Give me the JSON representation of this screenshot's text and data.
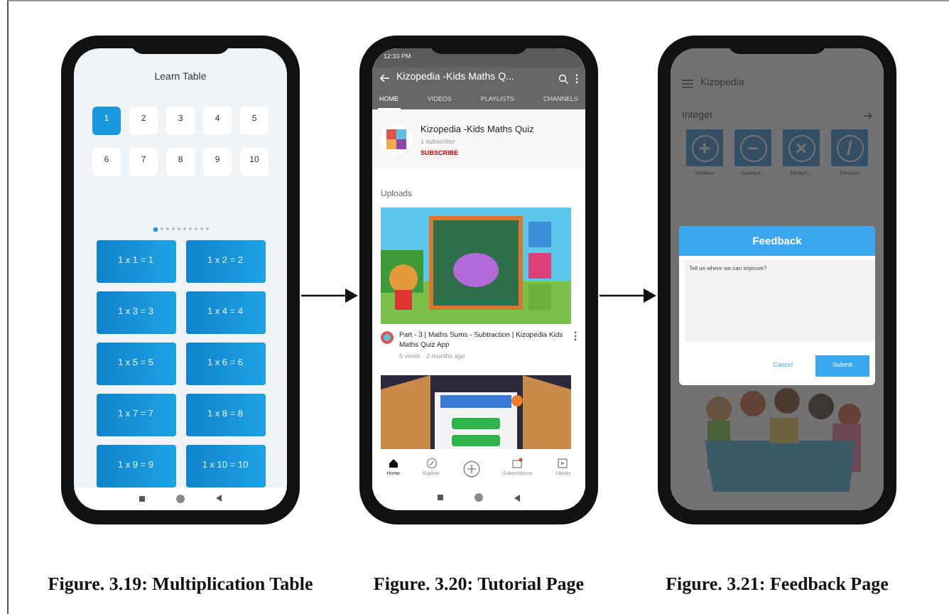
{
  "figures": [
    {
      "kind": "table",
      "caption": "Figure. 3.19: Multiplication Table",
      "title": "Learn Table",
      "numbers": [
        {
          "label": "1",
          "selected": true
        },
        {
          "label": "2",
          "selected": false
        },
        {
          "label": "3",
          "selected": false
        },
        {
          "label": "4",
          "selected": false
        },
        {
          "label": "5",
          "selected": false
        },
        {
          "label": "6",
          "selected": false
        },
        {
          "label": "7",
          "selected": false
        },
        {
          "label": "8",
          "selected": false
        },
        {
          "label": "9",
          "selected": false
        },
        {
          "label": "10",
          "selected": false
        }
      ],
      "pages": [
        {
          "selected": true
        },
        {
          "selected": false
        },
        {
          "selected": false
        },
        {
          "selected": false
        },
        {
          "selected": false
        },
        {
          "selected": false
        },
        {
          "selected": false
        },
        {
          "selected": false
        },
        {
          "selected": false
        },
        {
          "selected": false
        }
      ],
      "facts": [
        "1 x 1 = 1",
        "1 x 2 = 2",
        "1 x 3 = 3",
        "1 x 4 = 4",
        "1 x 5 = 5",
        "1 x 6 = 6",
        "1 x 7 = 7",
        "1 x 8 = 8",
        "1 x 9 = 9",
        "1 x 10 = 10"
      ]
    },
    {
      "kind": "tutorial",
      "caption": "Figure. 3.20: Tutorial Page",
      "time": "12:33 PM",
      "title": "Kizopedia -Kids Maths Q...",
      "tabs": [
        {
          "label": "HOME",
          "selected": true
        },
        {
          "label": "VIDEOS",
          "selected": false
        },
        {
          "label": "PLAYLISTS",
          "selected": false
        },
        {
          "label": "CHANNELS",
          "selected": false
        }
      ],
      "channel": {
        "name": "Kizopedia -Kids Maths Quiz",
        "subscribers": "1 subscriber",
        "subscribe": "SUBSCRIBE"
      },
      "section": "Uploads",
      "video": {
        "title": "Part - 3 | Maths Sums - Subtraction | Kizopedia Kids Maths Quiz App",
        "meta": "5 views · 2 months ago"
      },
      "bottom_nav": [
        {
          "label": "Home",
          "selected": true
        },
        {
          "label": "Explore",
          "selected": false
        },
        {
          "selected": false
        },
        {
          "label": "Subscriptions",
          "selected": false
        },
        {
          "label": "Library",
          "selected": false
        }
      ]
    },
    {
      "kind": "feedback",
      "caption": "Figure. 3.21: Feedback Page",
      "app": "Kizopedia",
      "section": "Integer",
      "tiles": [
        {
          "label": "Addition",
          "sign": "+"
        },
        {
          "label": "Subtract...",
          "sign": "−"
        },
        {
          "label": "Multipli...",
          "sign": "×"
        },
        {
          "label": "Division",
          "sign": "/"
        }
      ],
      "dialog": {
        "title": "Feedback",
        "placeholder": "Tell us where we can improve?",
        "cancel": "Cancel",
        "submit": "Submit"
      }
    }
  ]
}
